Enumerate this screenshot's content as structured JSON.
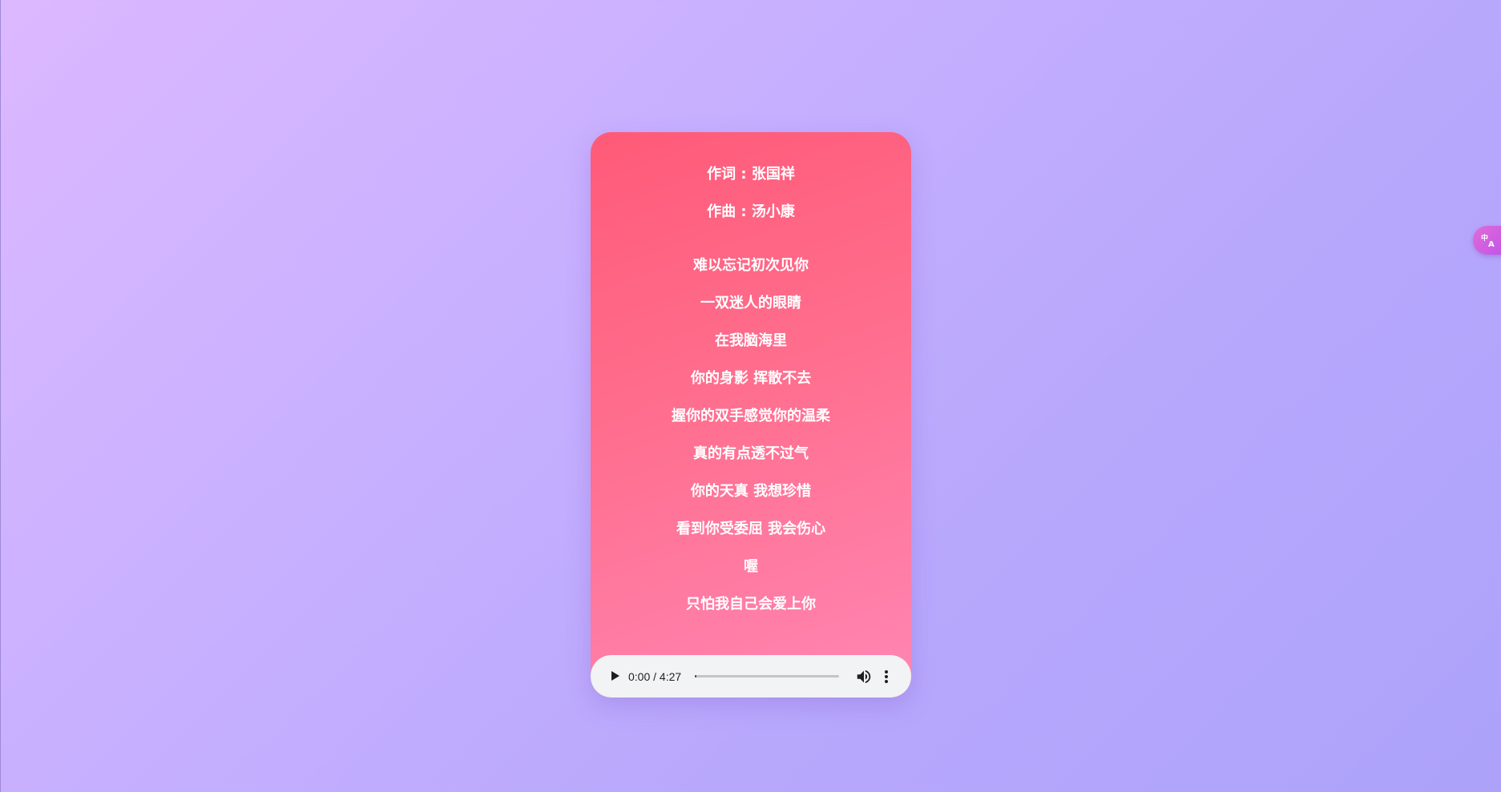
{
  "card": {
    "credits": {
      "lyricist": "作词 : 张国祥",
      "composer": "作曲 : 汤小康"
    },
    "lyrics": [
      "难以忘记初次见你",
      "一双迷人的眼睛",
      "在我脑海里",
      "你的身影 挥散不去",
      "握你的双手感觉你的温柔",
      "真的有点透不过气",
      "你的天真 我想珍惜",
      "看到你受委屈 我会伤心",
      "喔",
      "只怕我自己会爱上你"
    ]
  },
  "player": {
    "time_display": "0:00 / 4:27",
    "current_time": "0:00",
    "duration": "4:27",
    "progress_fraction": 0.0,
    "play_icon": "play-icon",
    "volume_icon": "volume-icon",
    "more_icon": "more-vert-icon"
  },
  "extension": {
    "icon": "translate-icon"
  },
  "colors": {
    "card_gradient_start": "#ff5a78",
    "card_gradient_end": "#ff86b4",
    "page_gradient_start": "#dcb8ff",
    "page_gradient_end": "#aca2fa",
    "player_background": "#f1f3f4",
    "lyric_text": "#ffffff"
  }
}
